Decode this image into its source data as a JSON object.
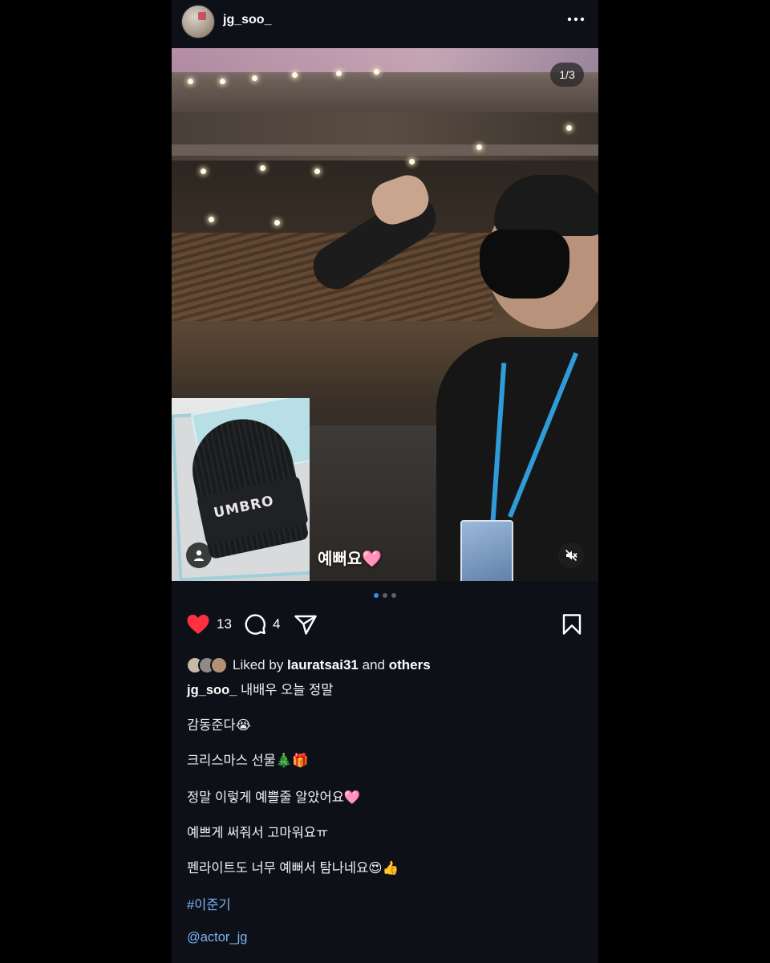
{
  "post": {
    "username": "jg_soo_",
    "more_icon": "more-horizontal-icon",
    "media": {
      "page_indicator": "1/3",
      "inset_text": "UMBRO",
      "sticker_text": "예뻐요",
      "sticker_emoji": "🩷",
      "current_page": 1,
      "total_pages": 3
    },
    "actions": {
      "like_count": "13",
      "comment_count": "4",
      "like_color": "#ff3040"
    },
    "liked_by": {
      "prefix": "Liked by ",
      "user": "lauratsai31",
      "middle": " and ",
      "others": "others"
    },
    "caption": {
      "username": "jg_soo_",
      "first_line": " 내배우 오늘 정말",
      "lines": [
        "감동준다😭",
        "크리스마스 선물🎄🎁",
        "정말 이렇게 예쁠줄 알았어요🩷",
        "예쁘게 써줘서 고마워요ㅠ",
        "펜라이트도 너무 예뻐서 탐나네요😍👍"
      ],
      "hashtag": "#이준기",
      "mention": "@actor_jg"
    }
  }
}
